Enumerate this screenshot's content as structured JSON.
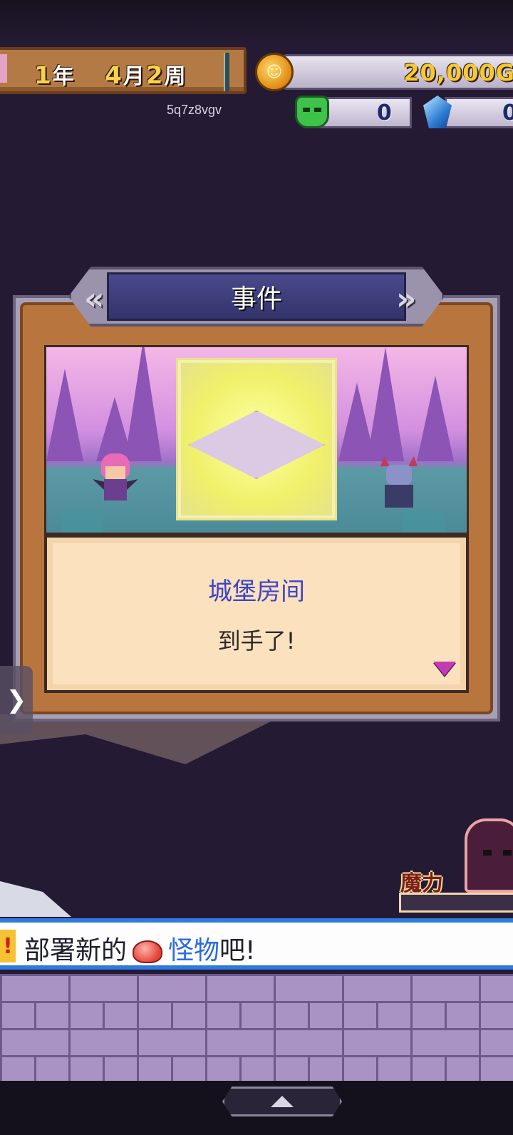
{
  "hud": {
    "date": {
      "year": "1",
      "year_unit": "年",
      "month": "4",
      "month_unit": "月",
      "week": "2",
      "week_unit": "周"
    },
    "user_id": "5q7z8vgv",
    "gold": "20,000G",
    "monster_count": "0",
    "crystal_count": "0"
  },
  "event_dialog": {
    "title": "事件",
    "item_name": "城堡房间",
    "message": "到手了!"
  },
  "status": {
    "mana_label": "魔力"
  },
  "notice": {
    "flag": "!",
    "text_before": "部署新的",
    "highlight": "怪物",
    "text_after": "吧!"
  },
  "icons": {
    "coin": "gold-coin-icon",
    "monster": "monster-icon",
    "crystal": "crystal-icon",
    "side_tab": "chevron-right-icon",
    "up": "triangle-up-icon",
    "next": "triangle-down-icon"
  },
  "colors": {
    "gold_text": "#f5c932",
    "item_name": "#3b45c9",
    "notice_border": "#2e7ae0",
    "notice_highlight": "#2a6be0"
  }
}
